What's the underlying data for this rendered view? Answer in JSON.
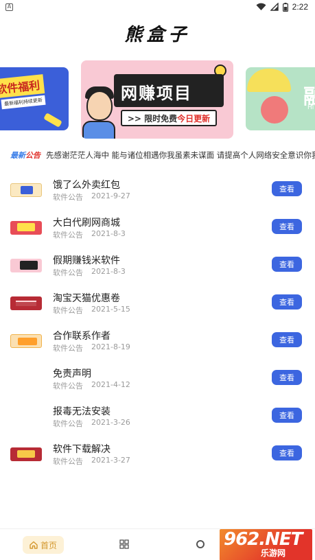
{
  "status_bar": {
    "left_icon": "A",
    "time": "2:22"
  },
  "app": {
    "title": "熊盒子"
  },
  "banners": {
    "left": {
      "title": "软件福利",
      "subtitle": "最新福利持续更新"
    },
    "center": {
      "sign": "网赚项目",
      "strip_prefix": ">> 限时免费 ",
      "strip_accent": "今日更新"
    },
    "right": {
      "letter": "融",
      "small": "Hi"
    }
  },
  "notice": {
    "tag_blue": "最新",
    "tag_red": "公告",
    "text": "先感谢茫茫人海中 能与诸位相遇你我虽素未谋面 请提高个人网络安全意识你我虽素未谋面"
  },
  "list": {
    "items": [
      {
        "title": "饿了么外卖红包",
        "category": "软件公告",
        "date": "2021-9-27",
        "button": "查看"
      },
      {
        "title": "大白代刷网商城",
        "category": "软件公告",
        "date": "2021-8-3",
        "button": "查看"
      },
      {
        "title": "假期赚钱米软件",
        "category": "软件公告",
        "date": "2021-8-3",
        "button": "查看"
      },
      {
        "title": "淘宝天猫优惠卷",
        "category": "软件公告",
        "date": "2021-5-15",
        "button": "查看"
      },
      {
        "title": "合作联系作者",
        "category": "软件公告",
        "date": "2021-8-19",
        "button": "查看"
      },
      {
        "title": "免责声明",
        "category": "软件公告",
        "date": "2021-4-12",
        "button": "查看"
      },
      {
        "title": "报毒无法安装",
        "category": "软件公告",
        "date": "2021-3-26",
        "button": "查看"
      },
      {
        "title": "软件下载解决",
        "category": "软件公告",
        "date": "2021-3-27",
        "button": "查看"
      }
    ]
  },
  "bottom_nav": {
    "home_label": "首页"
  },
  "watermark": {
    "big": "962.NET",
    "small": "乐游网"
  },
  "colors": {
    "accent_blue": "#3c66e0",
    "home_active": "#d4982e"
  }
}
